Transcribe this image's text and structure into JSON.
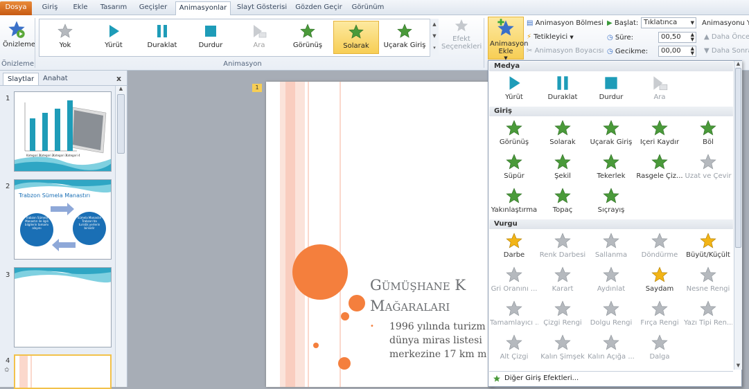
{
  "tabs": [
    "Dosya",
    "Giriş",
    "Ekle",
    "Tasarım",
    "Geçişler",
    "Animasyonlar",
    "Slayt Gösterisi",
    "Gözden Geçir",
    "Görünüm"
  ],
  "ribbon": {
    "preview_label": "Önizleme",
    "preview_group": "Önizleme",
    "animation_group": "Animasyon",
    "gallery": [
      {
        "label": "Yok",
        "icon": "gray-star-icon",
        "selected": false,
        "disabled": false
      },
      {
        "label": "Yürüt",
        "icon": "play-icon",
        "selected": false,
        "disabled": false
      },
      {
        "label": "Duraklat",
        "icon": "pause-icon",
        "selected": false,
        "disabled": false
      },
      {
        "label": "Durdur",
        "icon": "stop-icon",
        "selected": false,
        "disabled": false
      },
      {
        "label": "Ara",
        "icon": "seek-icon",
        "selected": false,
        "disabled": true
      },
      {
        "label": "Görünüş",
        "icon": "green-star-icon",
        "selected": false,
        "disabled": false
      },
      {
        "label": "Solarak",
        "icon": "green-star-icon",
        "selected": true,
        "disabled": false
      },
      {
        "label": "Uçarak Giriş",
        "icon": "green-star-icon",
        "selected": false,
        "disabled": false
      }
    ],
    "effect_options": "Efekt Seçenekleri",
    "add_animation": "Animasyon Ekle",
    "anim_pane": "Animasyon Bölmesi",
    "trigger": "Tetikleyici",
    "painter": "Animasyon Boyacısı",
    "start_label": "Başlat:",
    "start_value": "Tıklatınca",
    "duration_label": "Süre:",
    "duration_value": "00,50",
    "delay_label": "Gecikme:",
    "delay_value": "00,00",
    "reorder": "Animasyonu Ye",
    "earlier": "Daha Önce",
    "later": "Daha Sonra"
  },
  "leftpane": {
    "tab_slides": "Slaytlar",
    "tab_outline": "Anahat",
    "close": "x",
    "slides": [
      {
        "num": "1"
      },
      {
        "num": "2",
        "title": "Trabzon Sümela Manastırı",
        "left_circle": "Trabzon Sümela Manastırı ile ilgili bilgilerin tamamı alayını",
        "right_circle": "Sümela Manastırı Trabzon'da turistik yerlerin birisidir"
      },
      {
        "num": "3"
      },
      {
        "num": "4"
      }
    ],
    "chart_labels": [
      "Kategori 1",
      "Kategori 2",
      "Kategori 3",
      "Kategori 4"
    ],
    "star_marker": "✩"
  },
  "slide": {
    "badge": "1",
    "title_line1": "Gümüşhane K",
    "title_line2": "Mağaraları",
    "bullet": "•",
    "body_line1": "1996 yılında turizm",
    "body_line2": "dünya miras listesi",
    "body_line3": "merkezine 17 km m"
  },
  "menu": {
    "sections": [
      {
        "title": "Medya",
        "rows": [
          [
            {
              "label": "Yürüt",
              "icon": "play-icon",
              "disabled": false
            },
            {
              "label": "Duraklat",
              "icon": "pause-icon",
              "disabled": false
            },
            {
              "label": "Durdur",
              "icon": "stop-icon",
              "disabled": false
            },
            {
              "label": "Ara",
              "icon": "seek-icon",
              "disabled": true
            }
          ]
        ]
      },
      {
        "title": "Giriş",
        "rows": [
          [
            {
              "label": "Görünüş",
              "icon": "green-star-icon",
              "disabled": false
            },
            {
              "label": "Solarak",
              "icon": "green-star-icon",
              "disabled": false
            },
            {
              "label": "Uçarak Giriş",
              "icon": "green-star-icon",
              "disabled": false
            },
            {
              "label": "İçeri Kaydır",
              "icon": "green-star-icon",
              "disabled": false
            },
            {
              "label": "Böl",
              "icon": "green-star-icon",
              "disabled": false
            }
          ],
          [
            {
              "label": "Süpür",
              "icon": "green-star-icon",
              "disabled": false
            },
            {
              "label": "Şekil",
              "icon": "green-star-icon",
              "disabled": false
            },
            {
              "label": "Tekerlek",
              "icon": "green-star-icon",
              "disabled": false
            },
            {
              "label": "Rasgele Çiz...",
              "icon": "green-star-icon",
              "disabled": false
            },
            {
              "label": "Uzat ve Çevir",
              "icon": "gray-star-icon",
              "disabled": true
            }
          ],
          [
            {
              "label": "Yakınlaştırma",
              "icon": "green-star-icon",
              "disabled": false
            },
            {
              "label": "Topaç",
              "icon": "green-star-icon",
              "disabled": false
            },
            {
              "label": "Sıçrayış",
              "icon": "green-star-icon",
              "disabled": false
            }
          ]
        ]
      },
      {
        "title": "Vurgu",
        "rows": [
          [
            {
              "label": "Darbe",
              "icon": "gold-star-icon",
              "disabled": false
            },
            {
              "label": "Renk Darbesi",
              "icon": "gray-star-icon",
              "disabled": true
            },
            {
              "label": "Sallanma",
              "icon": "gray-star-icon",
              "disabled": true
            },
            {
              "label": "Döndürme",
              "icon": "gray-star-icon",
              "disabled": true
            },
            {
              "label": "Büyüt/Küçült",
              "icon": "gold-star-icon",
              "disabled": false
            }
          ],
          [
            {
              "label": "Gri Oranını ...",
              "icon": "gray-star-icon",
              "disabled": true
            },
            {
              "label": "Karart",
              "icon": "gray-star-icon",
              "disabled": true
            },
            {
              "label": "Aydınlat",
              "icon": "gray-star-icon",
              "disabled": true
            },
            {
              "label": "Saydam",
              "icon": "gold-star-icon",
              "disabled": false
            },
            {
              "label": "Nesne Rengi",
              "icon": "gray-star-icon",
              "disabled": true
            }
          ],
          [
            {
              "label": "Tamamlayıcı ...",
              "icon": "gray-star-icon",
              "disabled": true
            },
            {
              "label": "Çizgi Rengi",
              "icon": "gray-star-icon",
              "disabled": true
            },
            {
              "label": "Dolgu Rengi",
              "icon": "gray-star-icon",
              "disabled": true
            },
            {
              "label": "Fırça Rengi",
              "icon": "gray-star-icon",
              "disabled": true
            },
            {
              "label": "Yazı Tipi Ren...",
              "icon": "gray-star-icon",
              "disabled": true
            }
          ],
          [
            {
              "label": "Alt Çizgi",
              "icon": "gray-star-icon",
              "disabled": true
            },
            {
              "label": "Kalın Şimşek",
              "icon": "gray-star-icon",
              "disabled": true
            },
            {
              "label": "Kalın Açığa ...",
              "icon": "gray-star-icon",
              "disabled": true
            },
            {
              "label": "Dalga",
              "icon": "gray-star-icon",
              "disabled": true
            }
          ]
        ]
      }
    ],
    "footer": "Diğer Giriş Efektleri..."
  },
  "colors": {
    "green": "#4a9a3a",
    "gold": "#f2b416",
    "gray": "#b5b9be",
    "teal": "#1e9cb8",
    "orange": "#f47f3d",
    "accent": "#f7ce55"
  }
}
